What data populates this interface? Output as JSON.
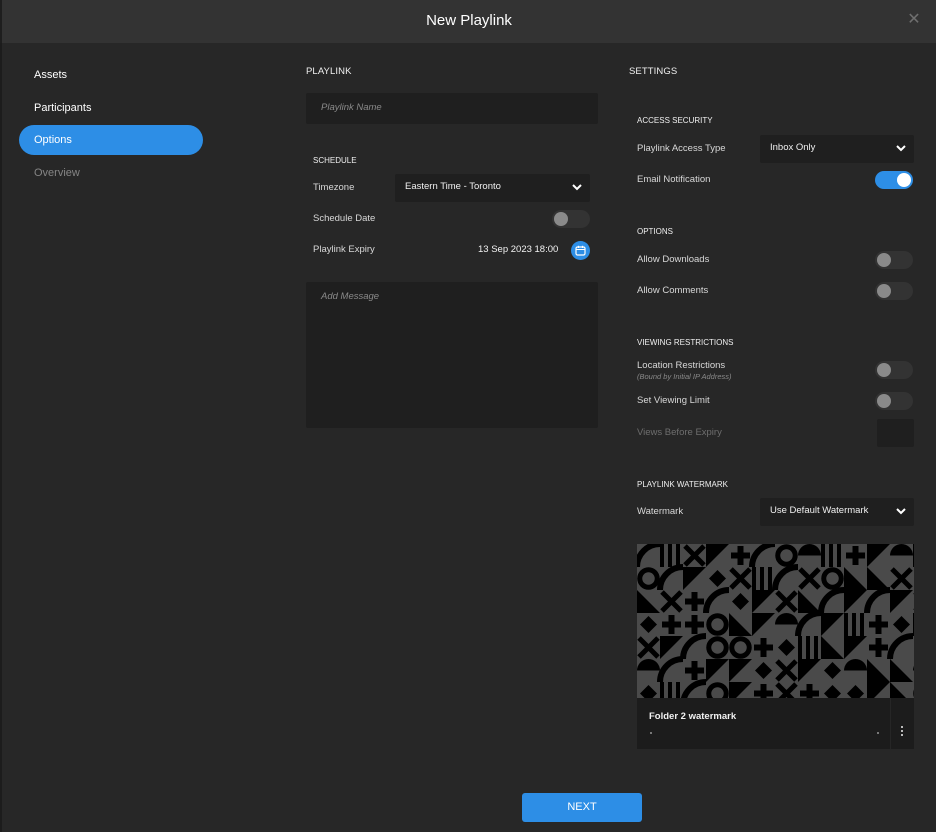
{
  "window": {
    "title": "New Playlink",
    "close_icon": "close-x-icon"
  },
  "sidebar": {
    "items": [
      {
        "label": "Assets",
        "state": "normal"
      },
      {
        "label": "Participants",
        "state": "normal"
      },
      {
        "label": "Options",
        "state": "active"
      },
      {
        "label": "Overview",
        "state": "disabled"
      }
    ]
  },
  "playlink": {
    "section_title": "PLAYLINK",
    "name_placeholder": "Playlink Name",
    "name_value": "",
    "schedule": {
      "title": "SCHEDULE",
      "timezone_label": "Timezone",
      "timezone_value": "Eastern Time - Toronto",
      "schedule_date_label": "Schedule Date",
      "schedule_date_enabled": false,
      "expiry_label": "Playlink Expiry",
      "expiry_value": "13 Sep 2023 18:00",
      "calendar_icon": "calendar-icon"
    },
    "message_placeholder": "Add Message",
    "message_value": ""
  },
  "settings": {
    "section_title": "SETTINGS",
    "access_security": {
      "title": "ACCESS SECURITY",
      "access_type_label": "Playlink Access Type",
      "access_type_value": "Inbox Only",
      "email_notification_label": "Email Notification",
      "email_notification_enabled": true
    },
    "options": {
      "title": "OPTIONS",
      "allow_downloads_label": "Allow Downloads",
      "allow_downloads_enabled": false,
      "allow_comments_label": "Allow Comments",
      "allow_comments_enabled": false
    },
    "viewing_restrictions": {
      "title": "VIEWING RESTRICTIONS",
      "location_label": "Location Restrictions",
      "location_sublabel": "(Bound by Initial IP Address)",
      "location_enabled": false,
      "viewing_limit_label": "Set Viewing Limit",
      "viewing_limit_enabled": false,
      "views_before_expiry_label": "Views Before Expiry",
      "views_before_expiry_value": ""
    },
    "watermark": {
      "title": "PLAYLINK WATERMARK",
      "label": "Watermark",
      "value": "Use Default Watermark",
      "card_name": "Folder 2 watermark",
      "more_icon": "more-vertical-icon"
    }
  },
  "footer": {
    "next_label": "NEXT"
  },
  "colors": {
    "accent": "#2d8ee6",
    "background": "#272727",
    "titlebar": "#333333",
    "input": "#1f1f1f"
  }
}
